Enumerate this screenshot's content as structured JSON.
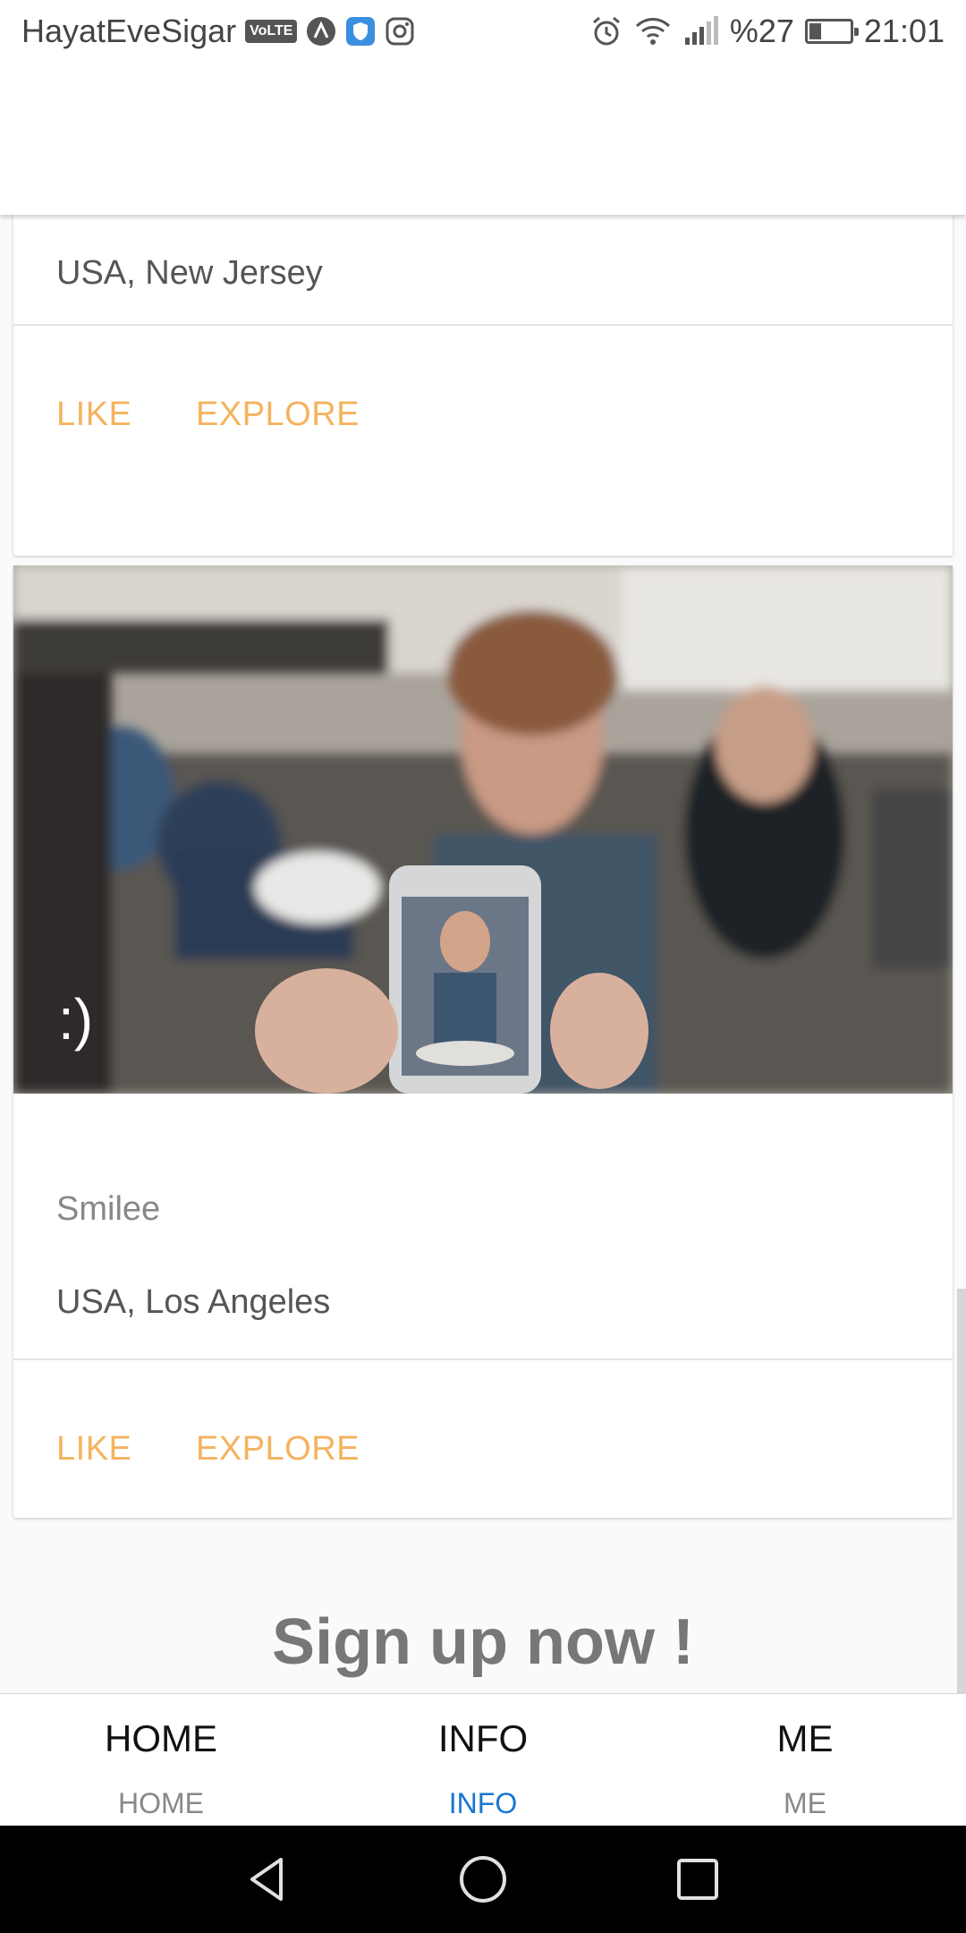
{
  "status_bar": {
    "carrier": "HayatEveSigar",
    "volte_label": "VoLTE",
    "battery_percent": "%27",
    "time": "21:01",
    "battery_level": 0.27
  },
  "cards": [
    {
      "location": "USA, New Jersey",
      "actions": {
        "like": "LIKE",
        "explore": "EXPLORE"
      }
    },
    {
      "overlay_text": ":)",
      "name": "Smilee",
      "location": "USA, Los Angeles",
      "actions": {
        "like": "LIKE",
        "explore": "EXPLORE"
      }
    }
  ],
  "signup_text": "Sign up now !",
  "tabs": [
    {
      "label": "HOME",
      "sublabel": "HOME",
      "active": false
    },
    {
      "label": "INFO",
      "sublabel": "INFO",
      "active": true
    },
    {
      "label": "ME",
      "sublabel": "ME",
      "active": false
    }
  ],
  "colors": {
    "action": "#f4b35e",
    "active_tab": "#1976d2",
    "inactive_tab": "#888888"
  },
  "nav_icons": [
    "back-icon",
    "home-circle-icon",
    "recents-square-icon"
  ]
}
